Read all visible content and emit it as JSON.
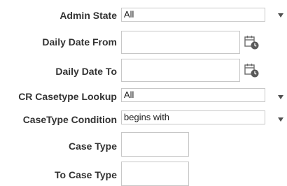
{
  "form": {
    "admin_state": {
      "label": "Admin State",
      "value": "All"
    },
    "daily_date_from": {
      "label": "Daily Date From",
      "value": ""
    },
    "daily_date_to": {
      "label": "Daily Date To",
      "value": ""
    },
    "cr_casetype_lookup": {
      "label": "CR Casetype Lookup",
      "value": "All"
    },
    "casetype_condition": {
      "label": "CaseType Condition",
      "value": "begins with"
    },
    "case_type": {
      "label": "Case Type",
      "value": ""
    },
    "to_case_type": {
      "label": "To Case Type",
      "value": ""
    }
  },
  "icons": {
    "dropdown": "chevron-down-icon",
    "calendar": "calendar-clock-icon"
  }
}
